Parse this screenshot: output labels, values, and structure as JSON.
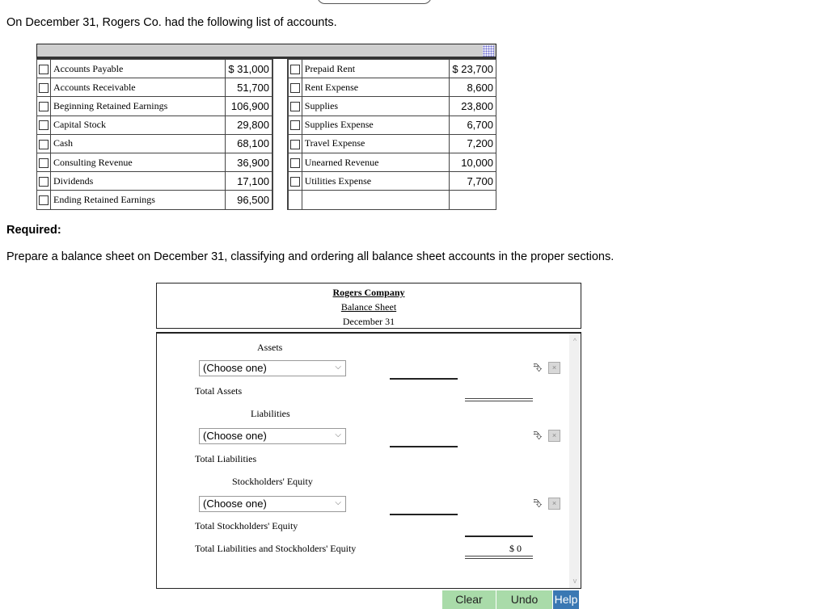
{
  "intro_text": "On December 31, Rogers Co. had the following list of accounts.",
  "accounts": {
    "left": [
      {
        "name": "Accounts Payable",
        "amount": "$ 31,000"
      },
      {
        "name": "Accounts Receivable",
        "amount": "51,700"
      },
      {
        "name": "Beginning Retained Earnings",
        "amount": "106,900"
      },
      {
        "name": "Capital Stock",
        "amount": "29,800"
      },
      {
        "name": "Cash",
        "amount": "68,100"
      },
      {
        "name": "Consulting Revenue",
        "amount": "36,900"
      },
      {
        "name": "Dividends",
        "amount": "17,100"
      },
      {
        "name": "Ending Retained Earnings",
        "amount": "96,500"
      }
    ],
    "right": [
      {
        "name": "Prepaid Rent",
        "amount": "$ 23,700"
      },
      {
        "name": "Rent Expense",
        "amount": "8,600"
      },
      {
        "name": "Supplies",
        "amount": "23,800"
      },
      {
        "name": "Supplies Expense",
        "amount": "6,700"
      },
      {
        "name": "Travel Expense",
        "amount": "7,200"
      },
      {
        "name": "Unearned Revenue",
        "amount": "10,000"
      },
      {
        "name": "Utilities Expense",
        "amount": "7,700"
      }
    ]
  },
  "required_label": "Required:",
  "instructions": "Prepare a balance sheet on December 31, classifying and ordering all balance sheet accounts in the proper sections.",
  "balance_sheet": {
    "company": "Rogers Company",
    "title": "Balance Sheet",
    "date": "December 31",
    "sections": {
      "assets": {
        "heading": "Assets",
        "select_value": "(Choose one)",
        "total_label": "Total Assets"
      },
      "liabilities": {
        "heading": "Liabilities",
        "select_value": "(Choose one)",
        "total_label": "Total Liabilities"
      },
      "equity": {
        "heading": "Stockholders' Equity",
        "select_value": "(Choose one)",
        "total_label": "Total Stockholders' Equity"
      }
    },
    "grand_total_label": "Total Liabilities and Stockholders' Equity",
    "grand_total_value": "$ 0"
  },
  "buttons": {
    "clear": "Clear",
    "undo": "Undo",
    "help": "Help"
  },
  "icons": {
    "add_row": "⮷",
    "delete_row": "×",
    "chevron": "⌵",
    "scroll_up": "^",
    "scroll_down": "v"
  }
}
